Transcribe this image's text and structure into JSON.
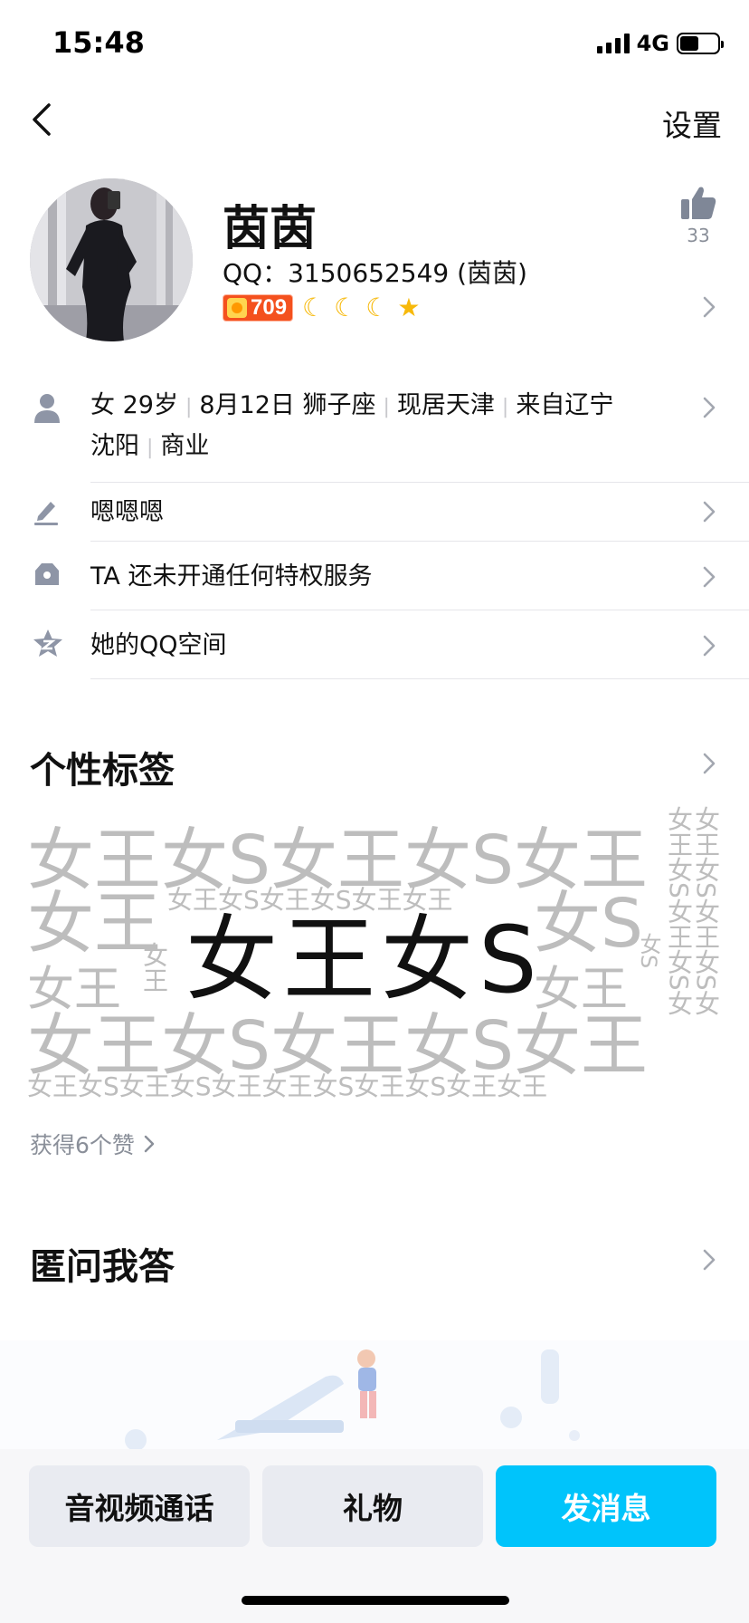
{
  "status_bar": {
    "time": "15:48",
    "network": "4G"
  },
  "nav": {
    "settings_label": "设置"
  },
  "profile": {
    "nickname": "茵茵",
    "qq_line": "QQ：3150652549 (茵茵)",
    "level": "709",
    "like_count": "33"
  },
  "info": {
    "details_line1": [
      "女 29岁",
      "8月12日 狮子座",
      "现居天津",
      "来自辽宁"
    ],
    "details_line2": [
      "沈阳",
      "商业"
    ],
    "signature": "嗯嗯嗯",
    "privilege": "TA 还未开通任何特权服务",
    "qzone": "她的QQ空间"
  },
  "tags": {
    "title": "个性标签",
    "line_a": "女王女S女王女S女王",
    "line_b_big": "女王",
    "line_b_small": "女王女S女王女S女王女王",
    "line_b_right": "女S",
    "line_c_left": "女王",
    "main_tag": "女王女S",
    "line_c_right": "女王",
    "line_d": "女王女S女王女S女王",
    "line_e": "女王女S女王女S女王女王女S女王女S女王女王",
    "vert_1": "女王女S女王女S女",
    "vert_2": "女王女S女王女S女",
    "vert_3": "女S",
    "vert_4": "女王",
    "likes": "获得6个赞"
  },
  "qa": {
    "title": "匿问我答"
  },
  "actions": {
    "call": "音视频通话",
    "gift": "礼物",
    "message": "发消息"
  },
  "colors": {
    "accent": "#00c4fb",
    "secondary_button": "#e9ebf1",
    "muted_text": "#8a8f99",
    "level_badge": "#f4511e",
    "moon": "#f7b90a"
  }
}
